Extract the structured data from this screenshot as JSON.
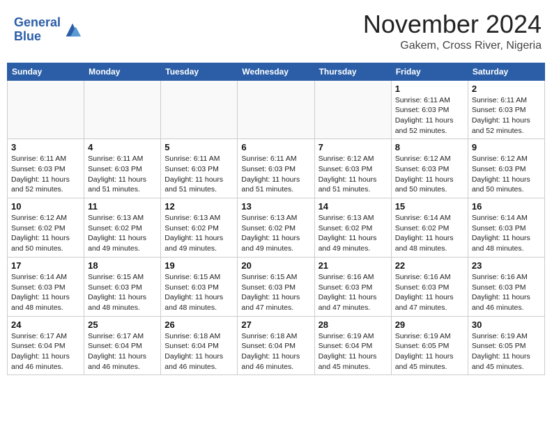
{
  "header": {
    "logo_line1": "General",
    "logo_line2": "Blue",
    "month": "November 2024",
    "location": "Gakem, Cross River, Nigeria"
  },
  "days_of_week": [
    "Sunday",
    "Monday",
    "Tuesday",
    "Wednesday",
    "Thursday",
    "Friday",
    "Saturday"
  ],
  "weeks": [
    [
      {
        "day": "",
        "info": ""
      },
      {
        "day": "",
        "info": ""
      },
      {
        "day": "",
        "info": ""
      },
      {
        "day": "",
        "info": ""
      },
      {
        "day": "",
        "info": ""
      },
      {
        "day": "1",
        "info": "Sunrise: 6:11 AM\nSunset: 6:03 PM\nDaylight: 11 hours\nand 52 minutes."
      },
      {
        "day": "2",
        "info": "Sunrise: 6:11 AM\nSunset: 6:03 PM\nDaylight: 11 hours\nand 52 minutes."
      }
    ],
    [
      {
        "day": "3",
        "info": "Sunrise: 6:11 AM\nSunset: 6:03 PM\nDaylight: 11 hours\nand 52 minutes."
      },
      {
        "day": "4",
        "info": "Sunrise: 6:11 AM\nSunset: 6:03 PM\nDaylight: 11 hours\nand 51 minutes."
      },
      {
        "day": "5",
        "info": "Sunrise: 6:11 AM\nSunset: 6:03 PM\nDaylight: 11 hours\nand 51 minutes."
      },
      {
        "day": "6",
        "info": "Sunrise: 6:11 AM\nSunset: 6:03 PM\nDaylight: 11 hours\nand 51 minutes."
      },
      {
        "day": "7",
        "info": "Sunrise: 6:12 AM\nSunset: 6:03 PM\nDaylight: 11 hours\nand 51 minutes."
      },
      {
        "day": "8",
        "info": "Sunrise: 6:12 AM\nSunset: 6:03 PM\nDaylight: 11 hours\nand 50 minutes."
      },
      {
        "day": "9",
        "info": "Sunrise: 6:12 AM\nSunset: 6:03 PM\nDaylight: 11 hours\nand 50 minutes."
      }
    ],
    [
      {
        "day": "10",
        "info": "Sunrise: 6:12 AM\nSunset: 6:02 PM\nDaylight: 11 hours\nand 50 minutes."
      },
      {
        "day": "11",
        "info": "Sunrise: 6:13 AM\nSunset: 6:02 PM\nDaylight: 11 hours\nand 49 minutes."
      },
      {
        "day": "12",
        "info": "Sunrise: 6:13 AM\nSunset: 6:02 PM\nDaylight: 11 hours\nand 49 minutes."
      },
      {
        "day": "13",
        "info": "Sunrise: 6:13 AM\nSunset: 6:02 PM\nDaylight: 11 hours\nand 49 minutes."
      },
      {
        "day": "14",
        "info": "Sunrise: 6:13 AM\nSunset: 6:02 PM\nDaylight: 11 hours\nand 49 minutes."
      },
      {
        "day": "15",
        "info": "Sunrise: 6:14 AM\nSunset: 6:02 PM\nDaylight: 11 hours\nand 48 minutes."
      },
      {
        "day": "16",
        "info": "Sunrise: 6:14 AM\nSunset: 6:03 PM\nDaylight: 11 hours\nand 48 minutes."
      }
    ],
    [
      {
        "day": "17",
        "info": "Sunrise: 6:14 AM\nSunset: 6:03 PM\nDaylight: 11 hours\nand 48 minutes."
      },
      {
        "day": "18",
        "info": "Sunrise: 6:15 AM\nSunset: 6:03 PM\nDaylight: 11 hours\nand 48 minutes."
      },
      {
        "day": "19",
        "info": "Sunrise: 6:15 AM\nSunset: 6:03 PM\nDaylight: 11 hours\nand 48 minutes."
      },
      {
        "day": "20",
        "info": "Sunrise: 6:15 AM\nSunset: 6:03 PM\nDaylight: 11 hours\nand 47 minutes."
      },
      {
        "day": "21",
        "info": "Sunrise: 6:16 AM\nSunset: 6:03 PM\nDaylight: 11 hours\nand 47 minutes."
      },
      {
        "day": "22",
        "info": "Sunrise: 6:16 AM\nSunset: 6:03 PM\nDaylight: 11 hours\nand 47 minutes."
      },
      {
        "day": "23",
        "info": "Sunrise: 6:16 AM\nSunset: 6:03 PM\nDaylight: 11 hours\nand 46 minutes."
      }
    ],
    [
      {
        "day": "24",
        "info": "Sunrise: 6:17 AM\nSunset: 6:04 PM\nDaylight: 11 hours\nand 46 minutes."
      },
      {
        "day": "25",
        "info": "Sunrise: 6:17 AM\nSunset: 6:04 PM\nDaylight: 11 hours\nand 46 minutes."
      },
      {
        "day": "26",
        "info": "Sunrise: 6:18 AM\nSunset: 6:04 PM\nDaylight: 11 hours\nand 46 minutes."
      },
      {
        "day": "27",
        "info": "Sunrise: 6:18 AM\nSunset: 6:04 PM\nDaylight: 11 hours\nand 46 minutes."
      },
      {
        "day": "28",
        "info": "Sunrise: 6:19 AM\nSunset: 6:04 PM\nDaylight: 11 hours\nand 45 minutes."
      },
      {
        "day": "29",
        "info": "Sunrise: 6:19 AM\nSunset: 6:05 PM\nDaylight: 11 hours\nand 45 minutes."
      },
      {
        "day": "30",
        "info": "Sunrise: 6:19 AM\nSunset: 6:05 PM\nDaylight: 11 hours\nand 45 minutes."
      }
    ]
  ]
}
